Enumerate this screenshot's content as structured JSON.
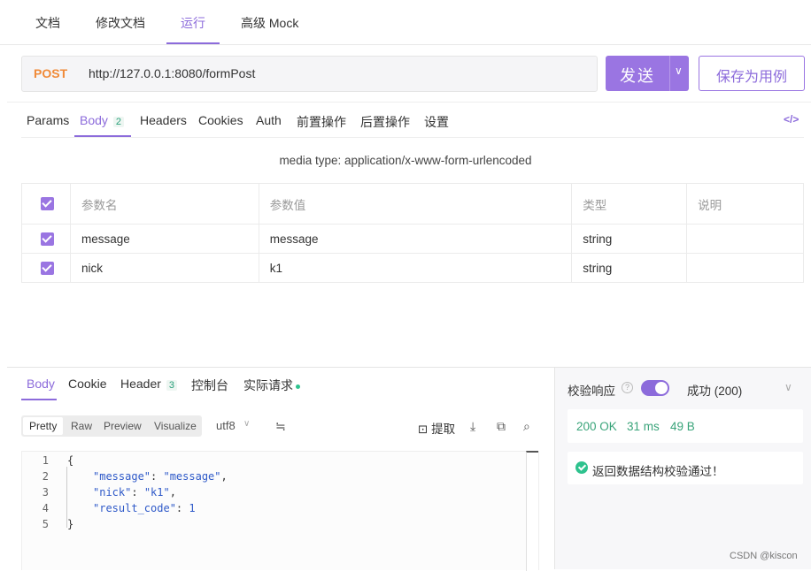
{
  "top_tabs": [
    "文档",
    "修改文档",
    "运行",
    "高级 Mock"
  ],
  "request": {
    "method": "POST",
    "url": "http://127.0.0.1:8080/formPost",
    "send_label": "发送",
    "save_label": "保存为用例"
  },
  "req_tabs": {
    "params": "Params",
    "body": "Body",
    "body_count": "2",
    "headers": "Headers",
    "cookies": "Cookies",
    "auth": "Auth",
    "pre": "前置操作",
    "post": "后置操作",
    "settings": "设置",
    "code": "</>"
  },
  "media_type": "media type: application/x-www-form-urlencoded",
  "params_table": {
    "headers": [
      "参数名",
      "参数值",
      "类型",
      "说明"
    ],
    "rows": [
      {
        "name": "message",
        "value": "message",
        "type": "string",
        "desc": ""
      },
      {
        "name": "nick",
        "value": "k1",
        "type": "string",
        "desc": ""
      }
    ]
  },
  "response": {
    "tabs": {
      "body": "Body",
      "cookie": "Cookie",
      "header": "Header",
      "header_count": "3",
      "console": "控制台",
      "actual": "实际请求"
    },
    "formats": [
      "Pretty",
      "Raw",
      "Preview",
      "Visualize"
    ],
    "encoding": "utf8",
    "extract_label": "提取",
    "code_lines": [
      "1",
      "2",
      "3",
      "4",
      "5"
    ],
    "json": {
      "open": "{",
      "k1": "\"message\"",
      "v1": "\"message\"",
      "k2": "\"nick\"",
      "v2": "\"k1\"",
      "k3": "\"result_code\"",
      "v3": "1",
      "close": "}"
    }
  },
  "validation": {
    "label": "校验响应",
    "toggle_on": true,
    "result": "成功 (200)",
    "status": "200 OK",
    "time": "31 ms",
    "size": "49 B",
    "message": "返回数据结构校验通过！"
  },
  "watermark": "CSDN @kiscon",
  "colors": {
    "accent": "#8c6bdb",
    "method": "#f08a38",
    "success": "#2ec28e"
  }
}
